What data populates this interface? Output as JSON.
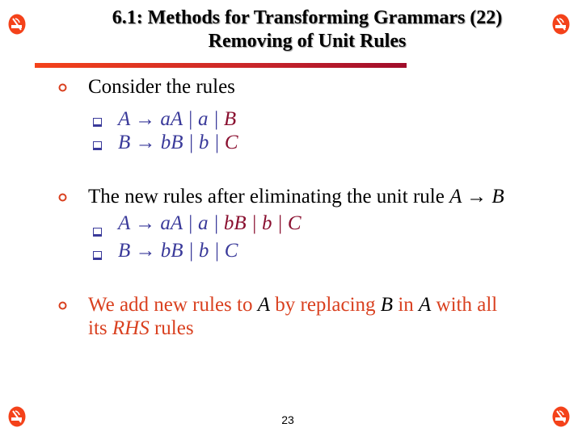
{
  "slide": {
    "title_line1": "6.1: Methods for Transforming Grammars (22)",
    "title_line2": "Removing of Unit Rules",
    "page_number": "23",
    "corner_icon": "no-smoking-icon",
    "colors": {
      "accent_red": "#f4421a",
      "rule_dark": "#a00c2a",
      "body_orange": "#d9401f",
      "rule_blue": "#3a3a9a",
      "rule_maroon": "#8a1030"
    }
  },
  "bullets": [
    {
      "text": "Consider the rules",
      "sub": [
        {
          "lhs": "A",
          "arrow": "→",
          "parts_blue": "aA | a | ",
          "parts_maroon": "B"
        },
        {
          "lhs": "B",
          "arrow": "→",
          "parts_blue": "bB | b | ",
          "parts_maroon": "C"
        }
      ]
    },
    {
      "text_prefix": "The new rules after eliminating the unit rule ",
      "text_math": "A → B",
      "sub": [
        {
          "lhs": "A",
          "arrow": "→",
          "parts_blue": "aA | a | ",
          "parts_maroon": "bB | b | C"
        },
        {
          "lhs": "B",
          "arrow": "→",
          "parts_blue": "bB | b | C",
          "parts_maroon": ""
        }
      ]
    },
    {
      "seg1": "We add new rules to ",
      "var1": "A",
      "seg2": " by replacing ",
      "var2": "B",
      "seg3": " in ",
      "var3": "A",
      "seg4": " with all",
      "seg5": "its ",
      "var4": "RHS",
      "seg6": " rules"
    }
  ]
}
